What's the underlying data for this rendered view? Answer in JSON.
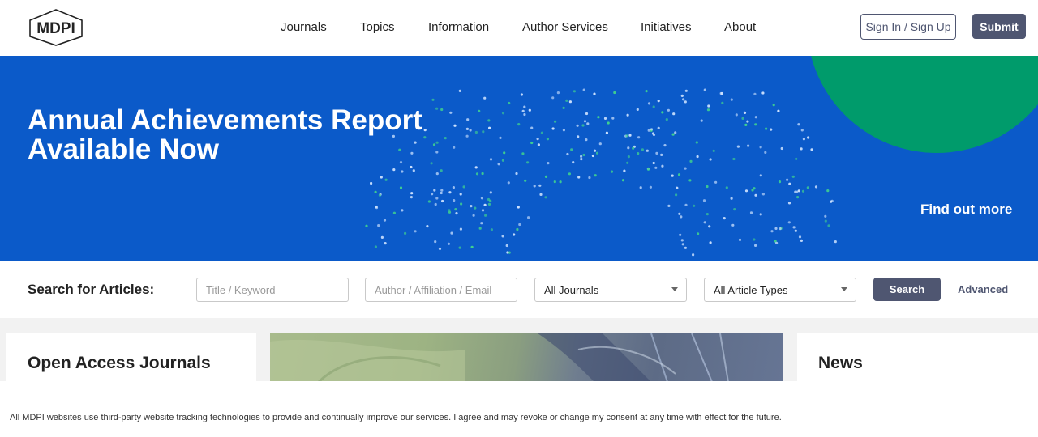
{
  "header": {
    "logo_text": "MDPI",
    "nav": [
      {
        "label": "Journals"
      },
      {
        "label": "Topics"
      },
      {
        "label": "Information"
      },
      {
        "label": "Author Services"
      },
      {
        "label": "Initiatives"
      },
      {
        "label": "About"
      }
    ],
    "signin_label": "Sign In / Sign Up",
    "submit_label": "Submit"
  },
  "banner": {
    "title": "Annual Achievements Report Available Now",
    "link": "Find out more",
    "colors": {
      "background": "#0b5ac9",
      "accent_circle": "#009b6b"
    }
  },
  "search": {
    "label": "Search for Articles:",
    "title_placeholder": "Title / Keyword",
    "author_placeholder": "Author / Affiliation / Email",
    "journal_selected": "All Journals",
    "type_selected": "All Article Types",
    "search_label": "Search",
    "advanced_label": "Advanced"
  },
  "sections": {
    "left_title": "Open Access Journals",
    "right_title": "News"
  },
  "cookie": {
    "text": "All MDPI websites use third-party website tracking technologies to provide and continually improve our services. I agree and may revoke or change my consent at any time with effect for the future."
  },
  "colors": {
    "primary": "#4f5671"
  }
}
